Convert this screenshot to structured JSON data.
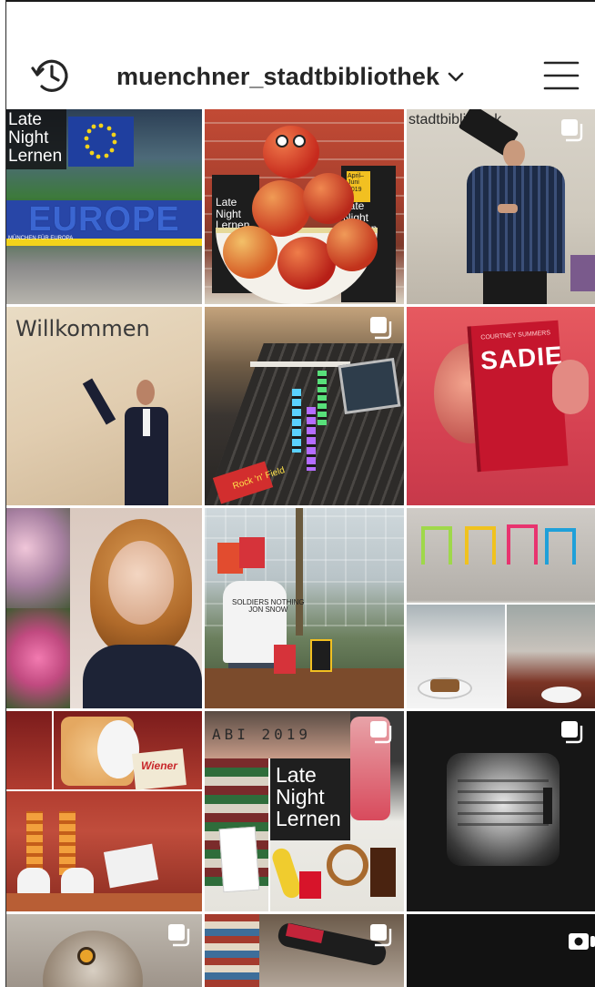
{
  "header": {
    "username": "muenchner_stadtbibliothek",
    "history_icon": "history-clock-icon",
    "dropdown_icon": "chevron-down-icon",
    "menu_icon": "hamburger-menu-icon"
  },
  "grid": {
    "posts": [
      {
        "label": "Late\nNight\nLernen",
        "sign": "EUROPE",
        "caption": "MÜNCHEN FÜR EUROPA"
      },
      {
        "poster_left": "Late\nNight\nLernen",
        "poster_right": "Late\nNight\nLernen",
        "poster_date": "April–\nJuni\n2019"
      },
      {
        "sign": "stadtbibliothek",
        "multiple": true
      },
      {
        "wall_text": "Willkommen"
      },
      {
        "console_label": "Rock 'n' Field",
        "multiple": true
      },
      {
        "book_title": "SADIE",
        "book_author": "COURTNEY SUMMERS"
      },
      {},
      {
        "shirt_text": "SOLDIERS NOTHING\nJON SNOW"
      },
      {},
      {
        "label": "Wiener"
      },
      {
        "knuckles": "ABI 2019",
        "label": "Late\nNight\nLernen",
        "multiple": true
      },
      {
        "multiple": true
      },
      {
        "multiple": true
      },
      {
        "multiple": true
      },
      {
        "video": true
      }
    ]
  },
  "colors": {
    "text": "#262626",
    "icon": "#262626",
    "red_poster": "#d9302c",
    "eu_blue": "#1f3f9f",
    "eu_gold": "#f2d31b"
  }
}
